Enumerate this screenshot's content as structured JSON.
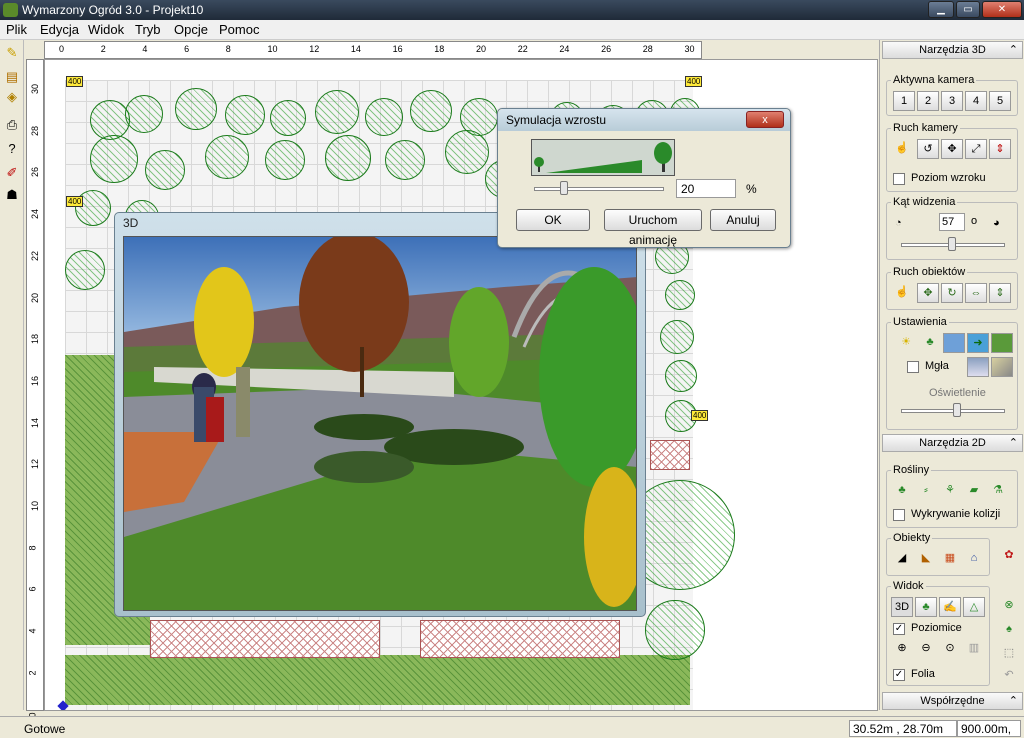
{
  "window": {
    "title": "Wymarzony Ogród 3.0 - Projekt10"
  },
  "menu": [
    "Plik",
    "Edycja",
    "Widok",
    "Tryb",
    "Opcje",
    "Pomoc"
  ],
  "ruler": {
    "top": [
      "0",
      "2",
      "4",
      "6",
      "8",
      "10",
      "12",
      "14",
      "16",
      "18",
      "20",
      "22",
      "24",
      "26",
      "28",
      "30"
    ],
    "left": [
      "30",
      "28",
      "26",
      "24",
      "22",
      "20",
      "18",
      "16",
      "14",
      "12",
      "10",
      "8",
      "6",
      "4",
      "2",
      "0"
    ]
  },
  "plan": {
    "dims": [
      "400",
      "400",
      "400",
      "400"
    ]
  },
  "view3d": {
    "title": "3D"
  },
  "growth_dialog": {
    "title": "Symulacja wzrostu",
    "value": "20",
    "unit": "%",
    "level": 0.2,
    "ok": "OK",
    "animate": "Uruchom animację",
    "cancel": "Anuluj",
    "close": "x"
  },
  "panel": {
    "tools3d": "Narzędzia 3D",
    "active_camera": "Aktywna kamera",
    "camera_nums": [
      "1",
      "2",
      "3",
      "4",
      "5"
    ],
    "camera_move": "Ruch kamery",
    "eye_level": "Poziom wzroku",
    "view_angle": "Kąt widzenia",
    "angle_value": "57",
    "angle_unit": "o",
    "angle_level": 0.45,
    "object_move": "Ruch obiektów",
    "settings": "Ustawienia",
    "fog": "Mgła",
    "lighting": "Oświetlenie",
    "lighting_level": 0.5,
    "tools2d": "Narzędzia 2D",
    "plants": "Rośliny",
    "collision": "Wykrywanie kolizji",
    "objects": "Obiekty",
    "view": "Widok",
    "view_3d_btn": "3D",
    "contours": "Poziomice",
    "foil": "Folia",
    "coords": "Współrzędne"
  },
  "status": {
    "text": "Gotowe",
    "coords": "30.52m , 28.70m",
    "zoom": "900.00m,"
  },
  "colors": {
    "lawn": "#8ab85a",
    "tree_outline": "#1a7a1a",
    "sky": "#6ea0d8",
    "path": "#8a8d98",
    "titlebar": "#1f2a38"
  }
}
